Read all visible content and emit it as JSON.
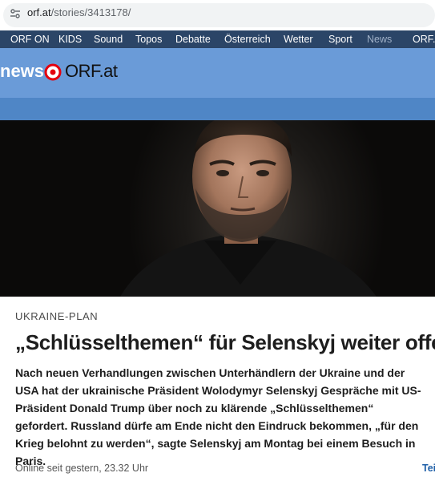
{
  "browser": {
    "url_host": "orf.at",
    "url_path": "/stories/3413178/"
  },
  "topnav": {
    "items": [
      "ORF ON",
      "KIDS",
      "Sound",
      "Topos",
      "Debatte",
      "Österreich",
      "Wetter",
      "Sport",
      "News",
      "ORF.a"
    ]
  },
  "brand": {
    "news_label": "news",
    "orf_label": "ORF.at",
    "accent": "#e3000f"
  },
  "article": {
    "kicker": "UKRAINE-PLAN",
    "headline": "„Schlüsselthemen“ für Selenskyj weiter offen",
    "lead": "Nach neuen Verhandlungen zwischen Unterhändlern der Ukraine und der USA hat der ukrainische Präsident Wolodymyr Selenskyj Gespräche mit US-Präsident Donald Trump über noch zu klärende „Schlüsselthemen“ gefordert. Russland dürfe am Ende nicht den Eindruck bekommen, „für den Krieg belohnt zu werden“, sagte Selenskyj am Montag bei einem Besuch in Paris.",
    "meta": "Online seit gestern, 23.32 Uhr",
    "share": "Tei"
  }
}
